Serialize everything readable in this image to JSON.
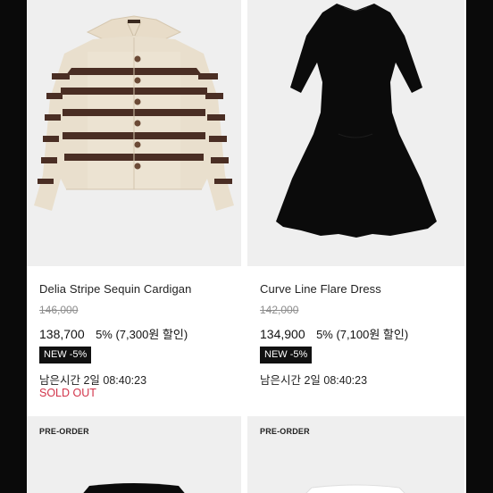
{
  "products": [
    {
      "name": "Delia Stripe Sequin Cardigan",
      "original_price": "146,000",
      "price": "138,700",
      "discount": "5% (7,300원 할인)",
      "badge": "NEW -5%",
      "time_left": "남은시간 2일 08:40:23",
      "status": "SOLD OUT"
    },
    {
      "name": "Curve Line Flare Dress",
      "original_price": "142,000",
      "price": "134,900",
      "discount": "5% (7,100원 할인)",
      "badge": "NEW -5%",
      "time_left": "남은시간 2일 08:40:23"
    }
  ],
  "next_row": [
    {
      "label": "PRE-ORDER"
    },
    {
      "label": "PRE-ORDER"
    }
  ],
  "colors": {
    "sold_out": "#d2344a",
    "badge_bg": "#111111",
    "image_bg": "#efefef"
  },
  "icons": [
    "cardigan-image",
    "dress-image",
    "black-top-image",
    "white-top-image"
  ]
}
